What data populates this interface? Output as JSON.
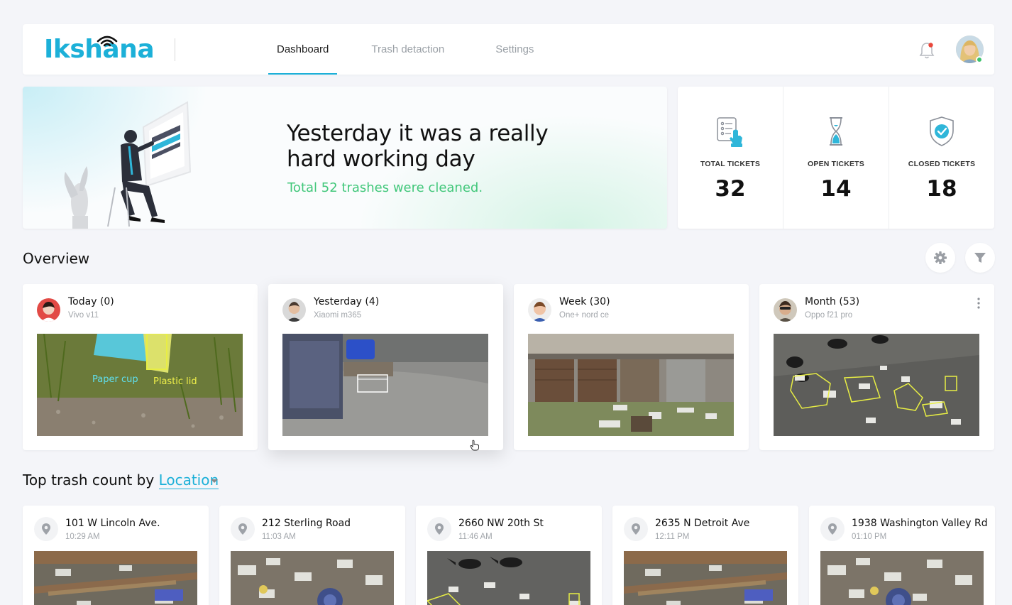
{
  "header": {
    "logo_text": "Ikshana",
    "nav": [
      "Dashboard",
      "Trash detaction",
      "Settings"
    ],
    "active_nav": "Dashboard",
    "icons": {
      "notification": "bell-icon",
      "profile": "avatar"
    },
    "accent": "#1cb0d8",
    "notification_dot_color": "#e9473b"
  },
  "hero": {
    "title": "Yesterday it was a really hard working day",
    "subtitle": "Total 52 trashes were cleaned.",
    "subtitle_color": "#41c77a"
  },
  "tickets": [
    {
      "label": "TOTAL TICKETS",
      "value": "32",
      "icon": "ticket-list-icon"
    },
    {
      "label": "OPEN TICKETS",
      "value": "14",
      "icon": "hourglass-icon"
    },
    {
      "label": "CLOSED TICKETS",
      "value": "18",
      "icon": "shield-check-icon"
    }
  ],
  "overview": {
    "title": "Overview",
    "actions": {
      "settings_icon": "gear-icon",
      "filter_icon": "filter-icon"
    },
    "cards": [
      {
        "title": "Today (0)",
        "device": "Vivo v11",
        "image_labels": [
          "Paper cup",
          "Plastic lid"
        ]
      },
      {
        "title": "Yesterday (4)",
        "device": "Xiaomi m365"
      },
      {
        "title": "Week (30)",
        "device": "One+ nord ce"
      },
      {
        "title": "Month (53)",
        "device": "Oppo f21 pro"
      }
    ]
  },
  "top_trash": {
    "prefix": "Top trash count by",
    "selector": "Location",
    "locations": [
      {
        "name": "101 W Lincoln Ave.",
        "time": "10:29 AM"
      },
      {
        "name": "212 Sterling Road",
        "time": "11:03 AM"
      },
      {
        "name": "2660 NW 20th St",
        "time": "11:46 AM"
      },
      {
        "name": "2635 N Detroit Ave",
        "time": "12:11 PM"
      },
      {
        "name": "1938 Washington Valley Rd",
        "time": "01:10 PM"
      }
    ]
  }
}
